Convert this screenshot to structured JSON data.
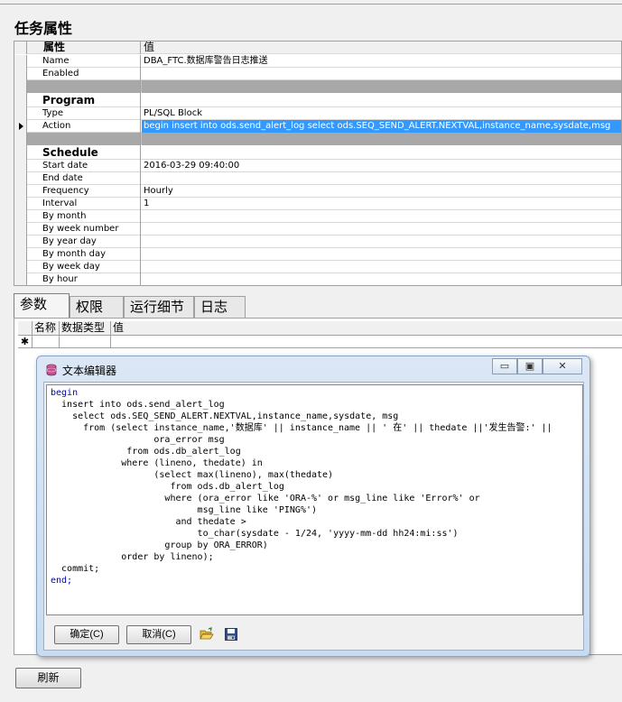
{
  "page": {
    "title": "任务属性"
  },
  "properties": {
    "header": {
      "key": "属性",
      "value": "值"
    },
    "rows": [
      {
        "key": "Name",
        "value": "DBA_FTC.数据库警告日志推送"
      },
      {
        "key": "Enabled",
        "value": ""
      },
      {
        "key": "Program",
        "value": ""
      },
      {
        "key": "Type",
        "value": "PL/SQL Block"
      },
      {
        "key": "Action",
        "value": "begin   insert into ods.send_alert_log     select ods.SEQ_SEND_ALERT.NEXTVAL,instance_name,sysdate,msg"
      },
      {
        "key": "Schedule",
        "value": ""
      },
      {
        "key": "Start date",
        "value": "2016-03-29 09:40:00"
      },
      {
        "key": "End date",
        "value": ""
      },
      {
        "key": "Frequency",
        "value": "Hourly"
      },
      {
        "key": "Interval",
        "value": "1"
      },
      {
        "key": "By month",
        "value": ""
      },
      {
        "key": "By week number",
        "value": ""
      },
      {
        "key": "By year day",
        "value": ""
      },
      {
        "key": "By month day",
        "value": ""
      },
      {
        "key": "By week day",
        "value": ""
      },
      {
        "key": "By hour",
        "value": ""
      }
    ]
  },
  "tabs": [
    {
      "label": "参数"
    },
    {
      "label": "权限"
    },
    {
      "label": "运行细节"
    },
    {
      "label": "日志"
    }
  ],
  "params_table": {
    "columns": [
      "名称",
      "数据类型",
      "值"
    ],
    "new_row_marker": "✱"
  },
  "editor": {
    "title": "文本编辑器",
    "window_buttons": {
      "minimize": "▭",
      "maximize": "▣",
      "close": "✕"
    },
    "ok_label": "确定(C)",
    "cancel_label": "取消(C)",
    "code_lines": [
      "begin",
      "  insert into ods.send_alert_log",
      "    select ods.SEQ_SEND_ALERT.NEXTVAL,instance_name,sysdate, msg",
      "      from (select instance_name,'数据库' || instance_name || ' 在' || thedate ||'发生告警:' ||",
      "                   ora_error msg",
      "              from ods.db_alert_log",
      "             where (lineno, thedate) in",
      "                   (select max(lineno), max(thedate)",
      "                      from ods.db_alert_log",
      "                     where (ora_error like 'ORA-%' or msg_line like 'Error%' or",
      "                           msg_line like 'PING%')",
      "                       and thedate >",
      "                           to_char(sysdate - 1/24, 'yyyy-mm-dd hh24:mi:ss')",
      "                     group by ORA_ERROR)",
      "             order by lineno);",
      "  commit;",
      "end;"
    ]
  },
  "footer": {
    "refresh_label": "刷新"
  }
}
